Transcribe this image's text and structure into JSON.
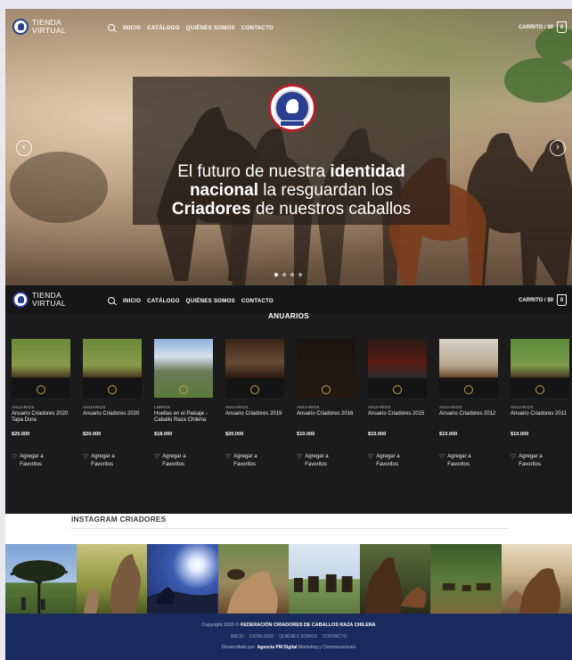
{
  "brand": {
    "line1": "TIENDA",
    "line2": "VIRTUAL"
  },
  "nav": {
    "items": [
      "INICIO",
      "CATÁLOGO",
      "QUIÉNES SOMOS",
      "CONTACTO"
    ],
    "cart": "CARRITO / $0",
    "cart_count": "0"
  },
  "hero": {
    "headline_1": "El futuro de nuestra ",
    "headline_1b": "identidad",
    "headline_2b": "nacional",
    "headline_2": " la resguardan los",
    "headline_3b": "Criadores",
    "headline_3": " de nuestros caballos",
    "prev_glyph": "‹",
    "next_glyph": "›"
  },
  "anuarios": {
    "title": "ANUARIOS",
    "fav_label_1": "Agregar a",
    "fav_label_2": "Favoritos",
    "products": [
      {
        "category": "ANUARIOS",
        "name": "Anuario Criadores 2020 Tapa Dura",
        "price": "$25.000"
      },
      {
        "category": "ANUARIOS",
        "name": "Anuario Criadores 2020",
        "price": "$20.000"
      },
      {
        "category": "LIBROS",
        "name": "Huellas en el Paisaje - Caballo Raza Chilena",
        "price": "$18.000"
      },
      {
        "category": "ANUARIOS",
        "name": "Anuario Criadores 2019",
        "price": "$20.000"
      },
      {
        "category": "ANUARIOS",
        "name": "Anuario Criadores 2016",
        "price": "$10.000"
      },
      {
        "category": "ANUARIOS",
        "name": "Anuario Criadores 2015",
        "price": "$10.000"
      },
      {
        "category": "ANUARIOS",
        "name": "Anuario Criadores 2012",
        "price": "$10.000"
      },
      {
        "category": "ANUARIOS",
        "name": "Anuario Criadores 2011",
        "price": "$10.000"
      }
    ]
  },
  "instagram": {
    "title": "INSTAGRAM CRIADORES"
  },
  "footer": {
    "copyright_prefix": "Copyright 2020 © ",
    "copyright_org": "FEDERACIÓN CRIADORES DE CABALLOS RAZA CHILENA",
    "links": [
      "INICIO",
      "CATÁLOGO",
      "QUIÉNES SOMOS",
      "CONTACTO"
    ],
    "credit_prefix": "Desarrollado por: ",
    "credit_agency": "Agencia PM Digital",
    "credit_suffix": " Marketing y Comunicaciones"
  },
  "colors": {
    "footer_bg": "#1a2a5e",
    "seal_blue": "#2b3f92",
    "seal_red": "#b3212c",
    "dark_bg": "#1b1b1b"
  }
}
